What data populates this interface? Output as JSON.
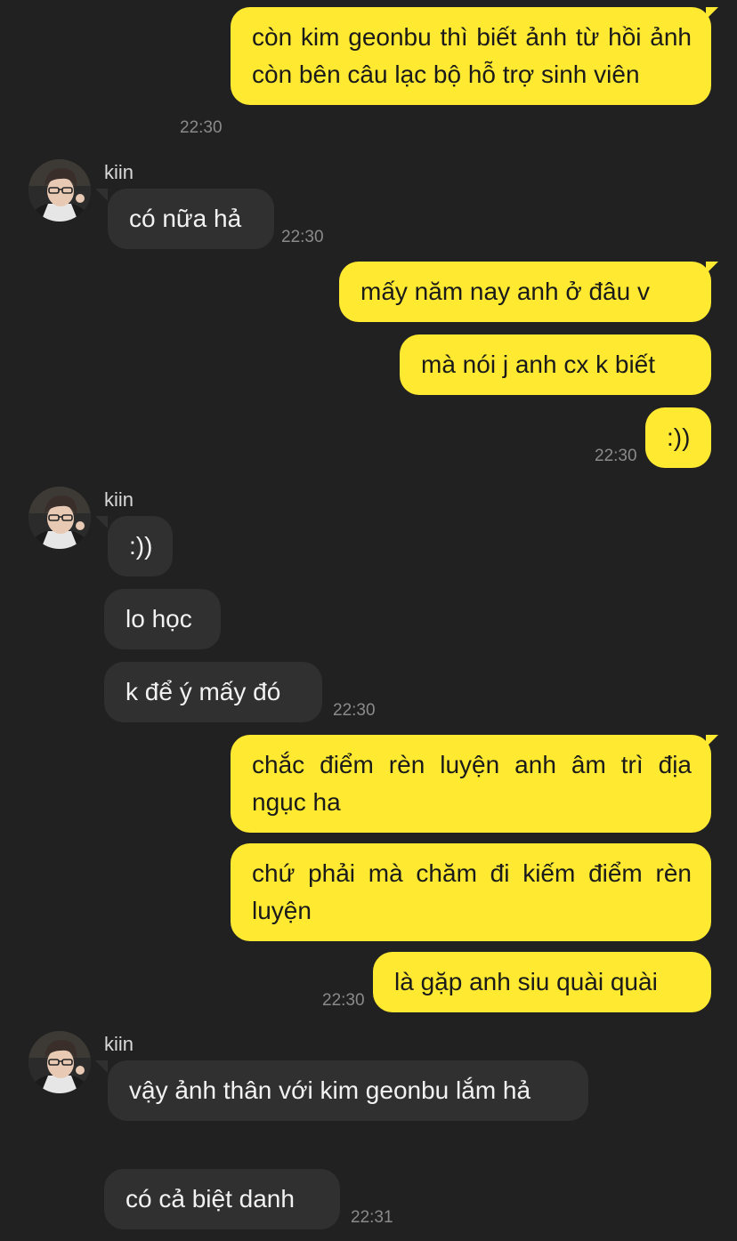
{
  "contact": {
    "name": "kiin",
    "avatar_icon": "profile-photo-icon"
  },
  "colors": {
    "background": "#212121",
    "outgoing_bubble": "#FFEA31",
    "incoming_bubble": "#303030",
    "timestamp": "#8a8a8a"
  },
  "messages": [
    {
      "dir": "out",
      "text": "còn kim geonbu thì biết ảnh từ hồi ảnh còn bên câu lạc bộ hỗ trợ sinh viên",
      "time": "22:30"
    },
    {
      "dir": "in",
      "sender": "kiin",
      "text": "có nữa hả",
      "time": "22:30"
    },
    {
      "dir": "out",
      "text": "mấy năm nay anh ở đâu v",
      "time": ""
    },
    {
      "dir": "out",
      "text": "mà nói j anh cx k biết",
      "time": ""
    },
    {
      "dir": "out",
      "text": ":))",
      "time": "22:30"
    },
    {
      "dir": "in",
      "sender": "kiin",
      "text": ":))",
      "time": ""
    },
    {
      "dir": "in",
      "text": "lo học",
      "time": ""
    },
    {
      "dir": "in",
      "text": "k để ý mấy đó",
      "time": "22:30"
    },
    {
      "dir": "out",
      "text": "chắc điểm rèn luyện anh âm trì địa ngục ha",
      "time": ""
    },
    {
      "dir": "out",
      "text": "chứ phải mà chăm đi kiếm điểm rèn luyện",
      "time": ""
    },
    {
      "dir": "out",
      "text": "là gặp anh siu quài quài",
      "time": "22:30"
    },
    {
      "dir": "in",
      "sender": "kiin",
      "text": "vậy ảnh thân với kim geonbu lắm hả",
      "time": ""
    },
    {
      "dir": "in",
      "text": "có cả biệt danh",
      "time": "22:31"
    }
  ]
}
